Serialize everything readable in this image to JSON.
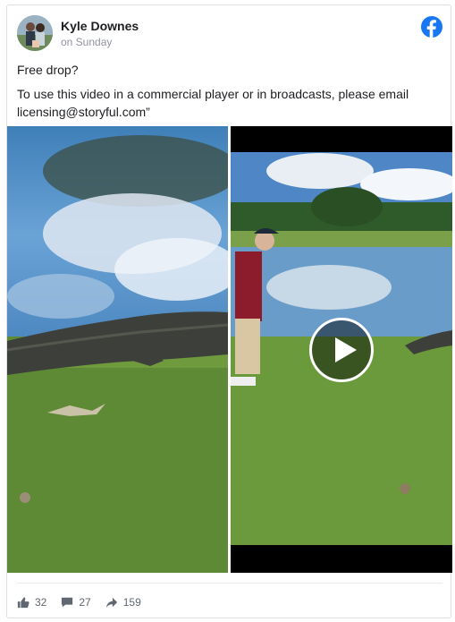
{
  "post": {
    "author": "Kyle Downes",
    "timestamp": "on Sunday",
    "text_line1": "Free drop?",
    "text_line2": "To use this video in a commercial player or in broadcasts, please email licensing@storyful.com”"
  },
  "icons": {
    "platform": "facebook-logo-icon",
    "like": "thumbs-up-icon",
    "comment": "comment-icon",
    "share": "share-arrow-icon",
    "play": "play-icon"
  },
  "stats": {
    "likes": "32",
    "comments": "27",
    "shares": "159"
  },
  "colors": {
    "facebook_blue": "#1877f2",
    "meta_gray": "#90949c",
    "border": "#dddfe2"
  }
}
